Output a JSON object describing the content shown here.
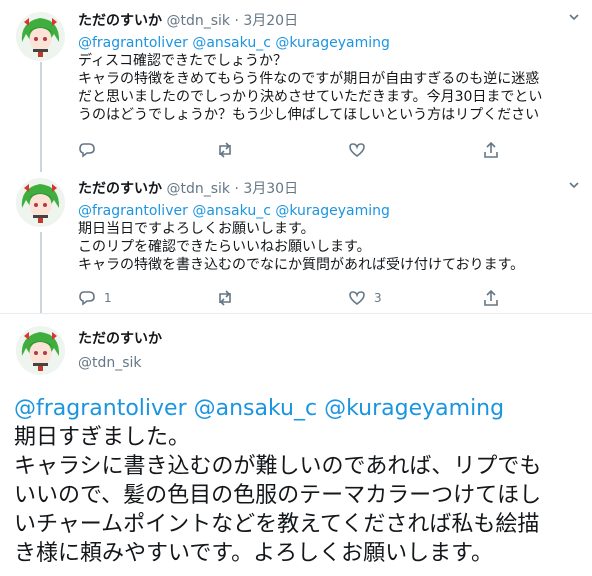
{
  "tweets": [
    {
      "name": "ただのすいか",
      "handle": "@tdn_sik",
      "dot": "·",
      "date": "3月20日",
      "mentions": [
        "@fragrantoliver",
        "@ansaku_c",
        "@kurageyaming"
      ],
      "lines": [
        "ディスコ確認できたでしょうか？",
        "キャラの特徴をきめてもらう件なのですが期日が自由すぎるのも逆に迷惑",
        "だと思いましたのでしっかり決めさせていただきます。今月30日までとい",
        "うのはどうでしょうか？もう少し伸ばしてほしいという方はリプください"
      ],
      "reply_count": "",
      "retweet_count": "",
      "like_count": ""
    },
    {
      "name": "ただのすいか",
      "handle": "@tdn_sik",
      "dot": "·",
      "date": "3月30日",
      "mentions": [
        "@fragrantoliver",
        "@ansaku_c",
        "@kurageyaming"
      ],
      "lines": [
        "期日当日ですよろしくお願いします。",
        "このリプを確認できたらいいねお願いします。",
        "キャラの特徴を書き込むのでなにか質問があれば受け付けております。"
      ],
      "reply_count": "1",
      "retweet_count": "",
      "like_count": "3"
    },
    {
      "name": "ただのすいか",
      "handle": "@tdn_sik",
      "mentions": [
        "@fragrantoliver",
        "@ansaku_c",
        "@kurageyaming"
      ],
      "lines": [
        "期日すぎました。",
        "キャラシに書き込むのが難しいのであれば、リプでも",
        "いいので、髪の色目の色服のテーマカラーつけてほし",
        "いチャームポイントなどを教えてくだされば私も絵描",
        "き様に頼みやすいです。よろしくお願いします。"
      ]
    }
  ],
  "icons": {
    "reply": "reply-icon",
    "retweet": "retweet-icon",
    "like": "heart-icon",
    "share": "share-icon",
    "caret": "chevron-down-icon"
  },
  "colors": {
    "link": "#1b95e0",
    "secondary": "#657786",
    "thread_line": "#ccd6dd"
  }
}
